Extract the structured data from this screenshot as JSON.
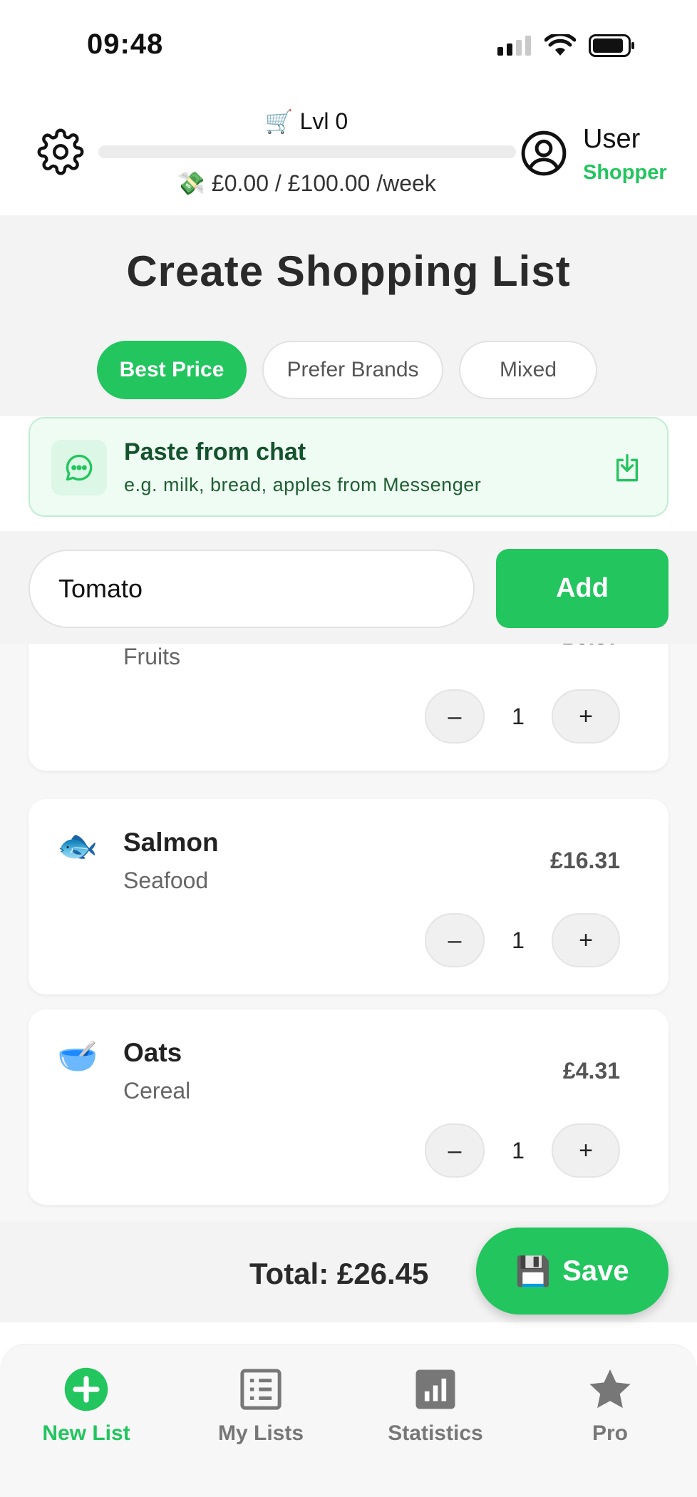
{
  "status_bar": {
    "time": "09:48"
  },
  "header": {
    "level_emoji": "🛒",
    "level_label": "Lvl 0",
    "level_progress": 0,
    "budget_emoji": "💸",
    "budget_text": "£0.00 / £100.00 /week",
    "user_name": "User",
    "user_role": "Shopper"
  },
  "main": {
    "title": "Create Shopping List",
    "modes": [
      {
        "label": "Best Price",
        "active": true
      },
      {
        "label": "Prefer Brands",
        "active": false
      },
      {
        "label": "Mixed",
        "active": false
      }
    ]
  },
  "paste": {
    "title": "Paste from chat",
    "subtitle": "e.g. milk, bread, apples from Messenger"
  },
  "input": {
    "value": "Tomato",
    "add_label": "Add"
  },
  "items": [
    {
      "emoji": "🍌",
      "name": "",
      "category": "Fruits",
      "price": "£0.57",
      "qty": "1"
    },
    {
      "emoji": "🐟",
      "name": "Salmon",
      "category": "Seafood",
      "price": "£16.31",
      "qty": "1"
    },
    {
      "emoji": "🥣",
      "name": "Oats",
      "category": "Cereal",
      "price": "£4.31",
      "qty": "1"
    }
  ],
  "controls": {
    "minus": "–",
    "plus": "+"
  },
  "footer": {
    "total": "Total: £26.45",
    "save_emoji": "💾",
    "save_label": "Save"
  },
  "nav": [
    {
      "label": "New List",
      "icon": "plus-circle-icon",
      "active": true
    },
    {
      "label": "My Lists",
      "icon": "list-icon",
      "active": false
    },
    {
      "label": "Statistics",
      "icon": "bar-chart-icon",
      "active": false
    },
    {
      "label": "Pro",
      "icon": "star-icon",
      "active": false
    }
  ],
  "colors": {
    "accent": "#22c55e",
    "paste_bg": "#effcf3"
  }
}
